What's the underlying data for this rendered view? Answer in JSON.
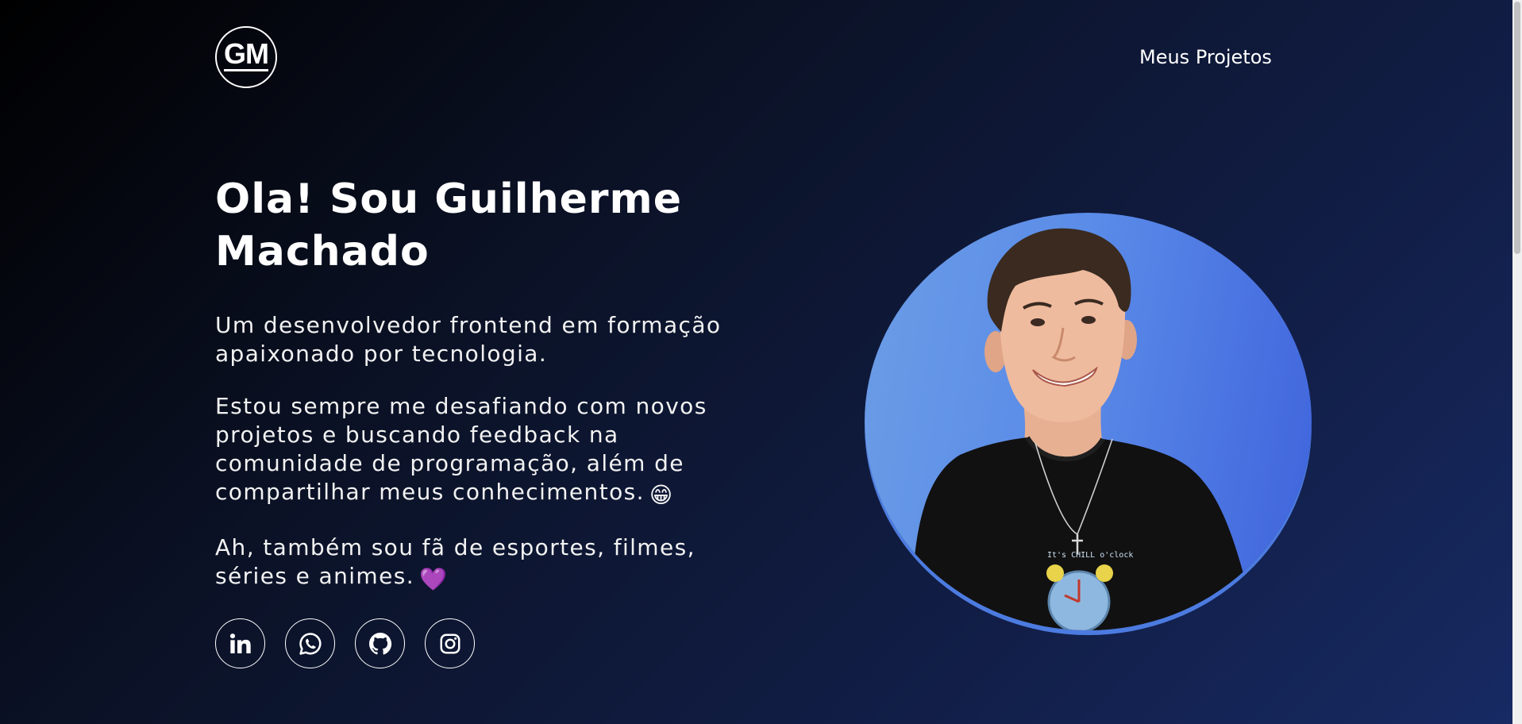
{
  "header": {
    "logo_text": "GM",
    "nav": {
      "projects_label": "Meus Projetos"
    }
  },
  "hero": {
    "title": "Ola! Sou Guilherme Machado",
    "paragraph_1": "Um desenvolvedor frontend em formação apaixonado por tecnologia.",
    "paragraph_2": "Estou sempre me desafiando com novos projetos e buscando feedback na comunidade de programação, além de compartilhar meus conhecimentos.",
    "paragraph_2_emoji": "😁",
    "paragraph_3": "Ah, também sou fã de esportes, filmes, séries e animes.",
    "paragraph_3_emoji": "💜"
  },
  "socials": [
    {
      "name": "LinkedIn",
      "icon": "linkedin-icon"
    },
    {
      "name": "WhatsApp",
      "icon": "whatsapp-icon"
    },
    {
      "name": "GitHub",
      "icon": "github-icon"
    },
    {
      "name": "Instagram",
      "icon": "instagram-icon"
    }
  ],
  "portrait": {
    "shirt_text": "It's CHILL o'clock"
  },
  "colors": {
    "background_start": "#000000",
    "background_end": "#172a63",
    "portrait_bg": "#5a8be8",
    "text": "#ffffff"
  }
}
